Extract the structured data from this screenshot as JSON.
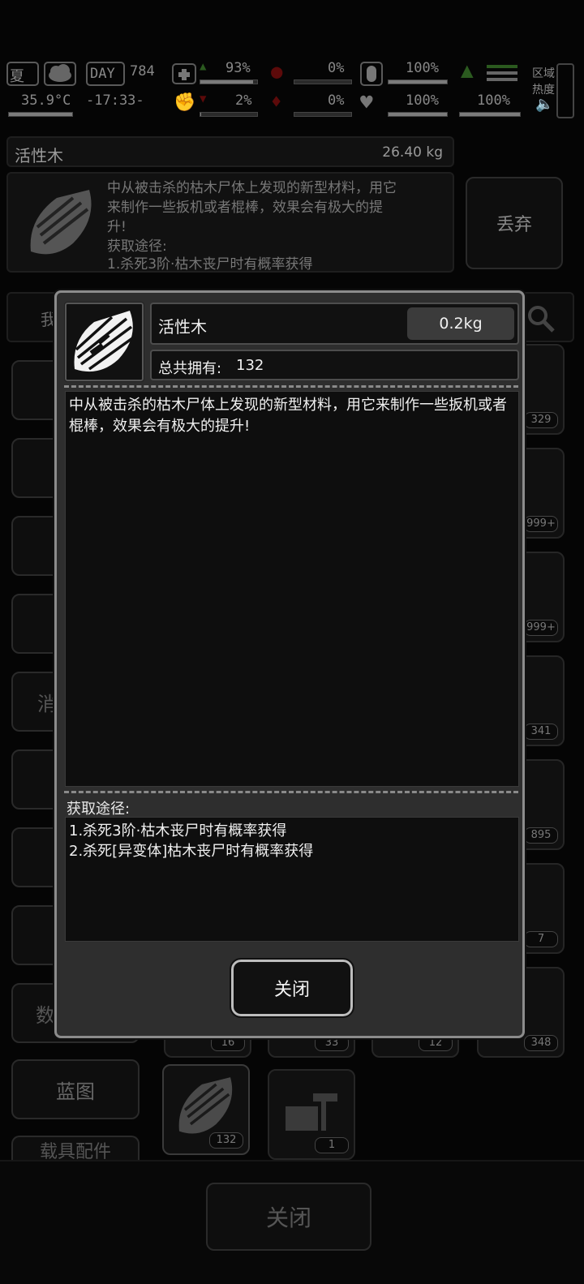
{
  "hud": {
    "season": "夏",
    "day_label": "DAY",
    "day_value": "784",
    "temperature": "35.9°C",
    "time": "-17:33-",
    "health_top": "93%",
    "health_bottom": "2%",
    "stat_red_top": "0%",
    "stat_red_bottom": "0%",
    "stat_mid_top": "100%",
    "stat_mid_bottom": "100%",
    "stat_right_bottom": "100%",
    "zone_label_1": "区域",
    "zone_label_2": "热度"
  },
  "background": {
    "item_name": "活性木",
    "item_weight": "26.40 kg",
    "item_desc_1": "中从被击杀的枯木尸体上发现的新型材料，用它",
    "item_desc_2": "来制作一些扳机或者棍棒，效果会有极大的提",
    "item_desc_3": "升!",
    "item_desc_4": "获取途径:",
    "item_desc_5": "1.杀死3阶·枯木丧尸时有概率获得",
    "discard_label": "丢弃",
    "side_tab_partial_1": "我",
    "side_tab_partial_2": "消",
    "side_tab_partial_3": "数",
    "blueprint_tab": "蓝图",
    "bottom_tab_partial": "载具配件",
    "close_label": "关闭",
    "grid_counts": [
      "329",
      "999+",
      "999+",
      "341",
      "895",
      "7",
      "348",
      "16",
      "33",
      "12"
    ],
    "bottom_items": [
      "132",
      "1"
    ]
  },
  "modal": {
    "item_name": "活性木",
    "weight": "0.2kg",
    "owned_label": "总共拥有:",
    "owned_value": "132",
    "description": "中从被击杀的枯木尸体上发现的新型材料，用它来制作一些扳机或者棍棒，效果会有极大的提升!",
    "source_title": "获取途径:",
    "sources": [
      "1.杀死3阶·枯木丧尸时有概率获得",
      "2.杀死[异变体]枯木丧尸时有概率获得"
    ],
    "close_label": "关闭"
  }
}
